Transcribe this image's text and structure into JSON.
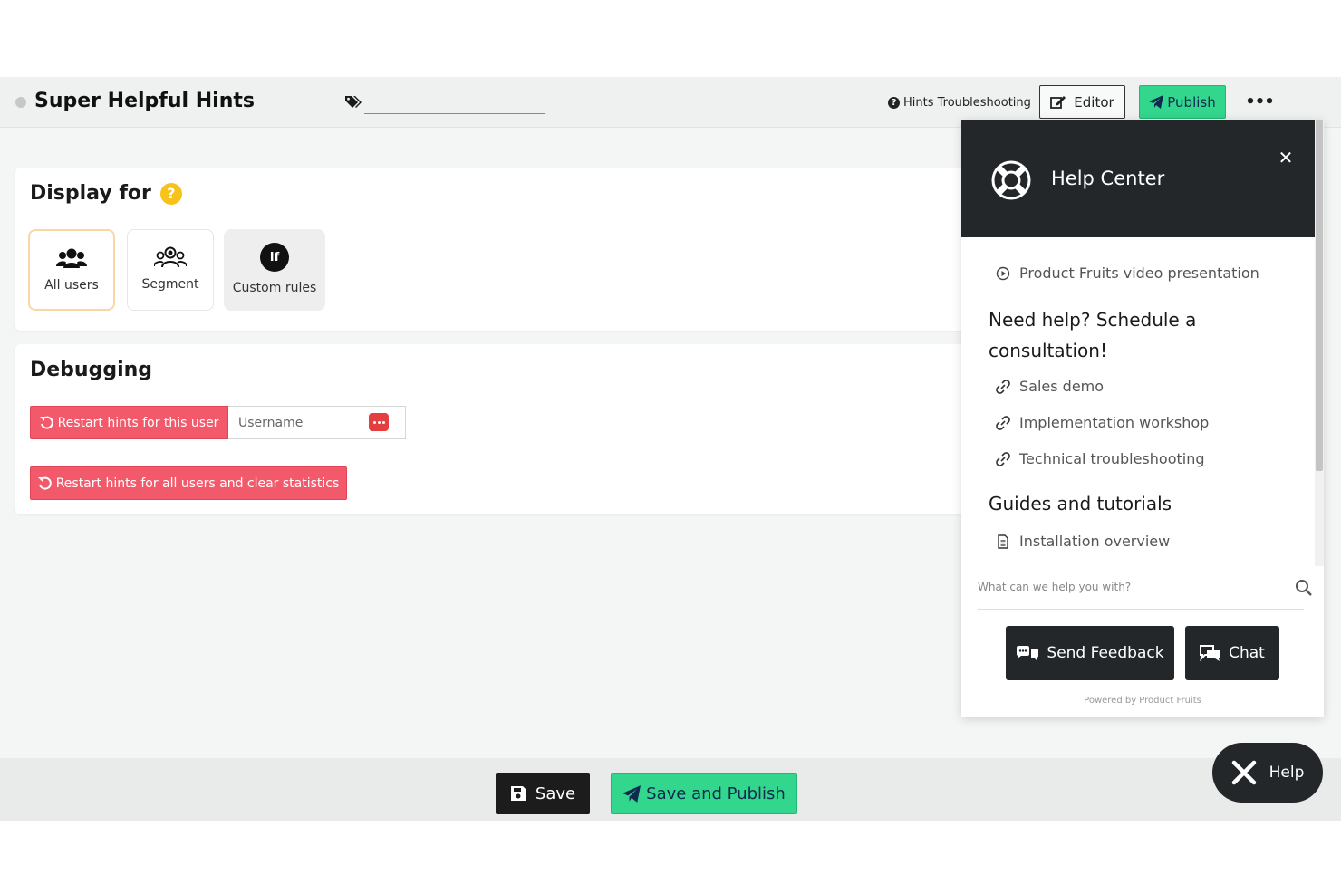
{
  "header": {
    "title": "Super Helpful Hints",
    "troubleshooting_label": "Hints Troubleshooting",
    "editor_label": "Editor",
    "publish_label": "Publish"
  },
  "display_for": {
    "heading": "Display for",
    "help_badge": "?",
    "options": [
      {
        "label": "All users",
        "selected": true
      },
      {
        "label": "Segment",
        "selected": false
      },
      {
        "label": "Custom rules",
        "selected": false,
        "badge": "If"
      }
    ]
  },
  "debugging": {
    "heading": "Debugging",
    "restart_user_label": "Restart hints for this user",
    "username_placeholder": "Username",
    "restart_all_label": "Restart hints for all users and clear statistics"
  },
  "footer": {
    "save_label": "Save",
    "save_publish_label": "Save and Publish"
  },
  "help_center": {
    "title": "Help Center",
    "video_link": "Product Fruits video presentation",
    "consult_heading": "Need help? Schedule a consultation!",
    "consult_links": [
      "Sales demo",
      "Implementation workshop",
      "Technical troubleshooting"
    ],
    "guides_heading": "Guides and tutorials",
    "guides_links": [
      "Installation overview"
    ],
    "search_placeholder": "What can we help you with?",
    "feedback_label": "Send Feedback",
    "chat_label": "Chat",
    "powered_by": "Powered by Product Fruits"
  },
  "help_toggle": {
    "label": "Help"
  },
  "colors": {
    "accent_green": "#33d68d",
    "danger_red": "#f25a6b",
    "dark": "#23272a",
    "help_yellow": "#f7c21a"
  }
}
